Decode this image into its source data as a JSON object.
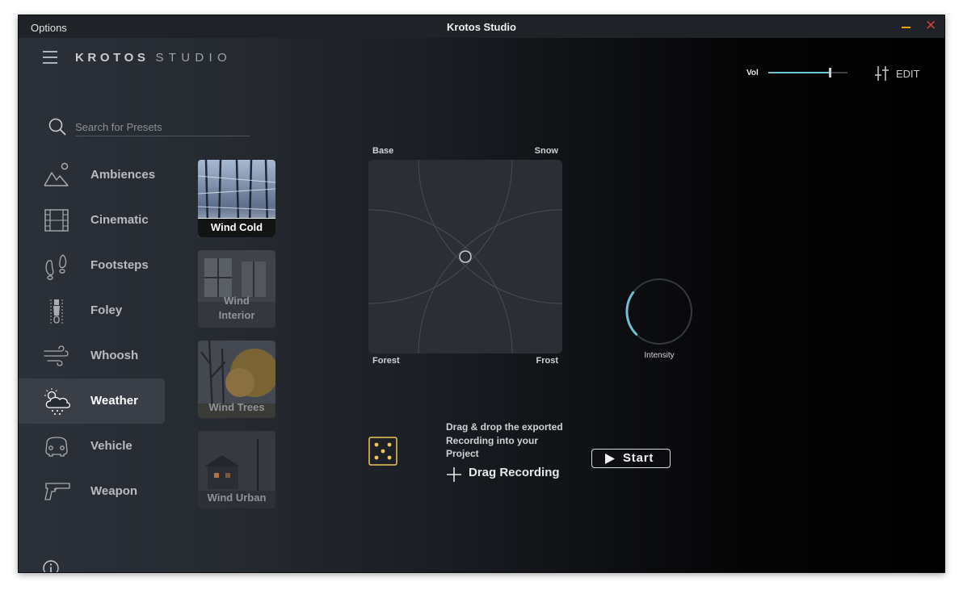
{
  "window": {
    "menu_label": "Options",
    "title": "Krotos Studio"
  },
  "header": {
    "logo_primary": "KROTOS",
    "logo_secondary": "STUDIO",
    "volume_label": "Vol",
    "volume_level": 0.78,
    "edit_label": "EDIT"
  },
  "search": {
    "placeholder": "Search for Presets",
    "value": ""
  },
  "categories": [
    {
      "label": "Ambiences",
      "icon": "mountain-icon"
    },
    {
      "label": "Cinematic",
      "icon": "film-strip-icon"
    },
    {
      "label": "Footsteps",
      "icon": "footprints-icon"
    },
    {
      "label": "Foley",
      "icon": "zipper-icon"
    },
    {
      "label": "Whoosh",
      "icon": "wind-lines-icon"
    },
    {
      "label": "Weather",
      "icon": "cloud-weather-icon",
      "active": true
    },
    {
      "label": "Vehicle",
      "icon": "car-front-icon"
    },
    {
      "label": "Weapon",
      "icon": "pistol-icon"
    }
  ],
  "presets": [
    {
      "label": "Wind Cold",
      "selected": true
    },
    {
      "label": "Wind Interior",
      "selected": false
    },
    {
      "label": "Wind Trees",
      "selected": false
    },
    {
      "label": "Wind Urban",
      "selected": false
    }
  ],
  "xy_pad": {
    "top_left": "Base",
    "top_right": "Snow",
    "bottom_left": "Forest",
    "bottom_right": "Frost",
    "puck_x": 0.5,
    "puck_y": 0.5
  },
  "intensity": {
    "label": "Intensity",
    "value": 0.3,
    "accent": "#6ec1d3"
  },
  "recording": {
    "info_text": "Drag & drop the exported Recording into your Project",
    "drag_label": "Drag Recording",
    "start_label": "Start"
  },
  "colors": {
    "dice_accent": "#f0c75a",
    "minimize": "#e8a317",
    "close": "#d23b3b"
  }
}
